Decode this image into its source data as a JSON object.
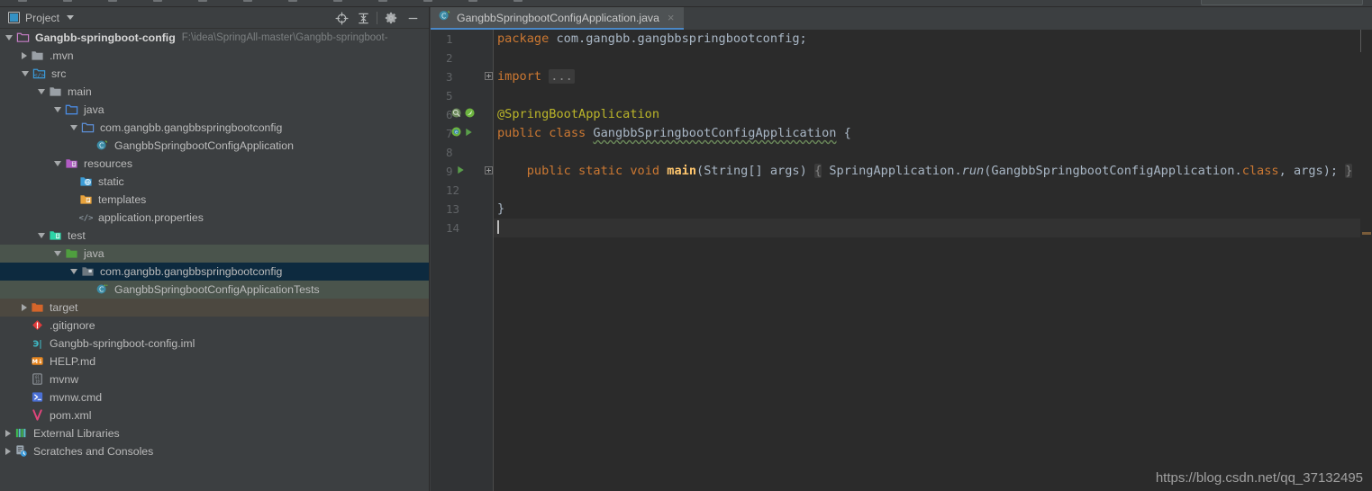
{
  "panel": {
    "title": "Project",
    "buttons": [
      {
        "name": "locate-icon",
        "label": "Select Opened File"
      },
      {
        "name": "collapse-all-icon",
        "label": "Collapse All"
      },
      {
        "name": "gear-icon",
        "label": "Settings"
      },
      {
        "name": "minimize-icon",
        "label": "Hide"
      }
    ]
  },
  "tree": [
    {
      "label": "Gangbb-springboot-config",
      "path": "F:\\idea\\SpringAll-master\\Gangbb-springboot-",
      "indent": 0,
      "arrow": "open",
      "icon": "module-folder-icon",
      "bold": true,
      "highlight": "none"
    },
    {
      "label": ".mvn",
      "indent": 1,
      "arrow": "closed",
      "icon": "folder-icon",
      "bold": false,
      "highlight": "none"
    },
    {
      "label": "src",
      "indent": 1,
      "arrow": "open",
      "icon": "source-root-icon",
      "bold": false,
      "highlight": "none"
    },
    {
      "label": "main",
      "indent": 2,
      "arrow": "open",
      "icon": "folder-icon",
      "bold": false,
      "highlight": "none"
    },
    {
      "label": "java",
      "indent": 3,
      "arrow": "open",
      "icon": "java-source-folder-icon",
      "bold": false,
      "highlight": "none"
    },
    {
      "label": "com.gangbb.gangbbspringbootconfig",
      "indent": 4,
      "arrow": "open",
      "icon": "package-icon",
      "bold": false,
      "highlight": "none"
    },
    {
      "label": "GangbbSpringbootConfigApplication",
      "indent": 5,
      "arrow": "none",
      "icon": "spring-class-icon",
      "bold": false,
      "highlight": "none"
    },
    {
      "label": "resources",
      "indent": 3,
      "arrow": "open",
      "icon": "resources-root-icon",
      "bold": false,
      "highlight": "none"
    },
    {
      "label": "static",
      "indent": 4,
      "arrow": "none",
      "icon": "static-folder-icon",
      "bold": false,
      "highlight": "none"
    },
    {
      "label": "templates",
      "indent": 4,
      "arrow": "none",
      "icon": "templates-folder-icon",
      "bold": false,
      "highlight": "none"
    },
    {
      "label": "application.properties",
      "indent": 4,
      "arrow": "none",
      "icon": "properties-file-icon",
      "bold": false,
      "highlight": "none"
    },
    {
      "label": "test",
      "indent": 2,
      "arrow": "open",
      "icon": "test-root-icon",
      "bold": false,
      "highlight": "none"
    },
    {
      "label": "java",
      "indent": 3,
      "arrow": "open",
      "icon": "test-source-folder-icon",
      "bold": false,
      "highlight": "green"
    },
    {
      "label": "com.gangbb.gangbbspringbootconfig",
      "indent": 4,
      "arrow": "open",
      "icon": "test-package-icon",
      "bold": false,
      "highlight": "blue"
    },
    {
      "label": "GangbbSpringbootConfigApplicationTests",
      "indent": 5,
      "arrow": "none",
      "icon": "test-class-icon",
      "bold": false,
      "highlight": "green"
    },
    {
      "label": "target",
      "indent": 1,
      "arrow": "closed",
      "icon": "excluded-folder-icon",
      "bold": false,
      "highlight": "brown"
    },
    {
      "label": ".gitignore",
      "indent": 1,
      "arrow": "none",
      "icon": "gitignore-icon",
      "bold": false,
      "highlight": "none"
    },
    {
      "label": "Gangbb-springboot-config.iml",
      "indent": 1,
      "arrow": "none",
      "icon": "iml-file-icon",
      "bold": false,
      "highlight": "none"
    },
    {
      "label": "HELP.md",
      "indent": 1,
      "arrow": "none",
      "icon": "markdown-file-icon",
      "bold": false,
      "highlight": "none"
    },
    {
      "label": "mvnw",
      "indent": 1,
      "arrow": "none",
      "icon": "binary-file-icon",
      "bold": false,
      "highlight": "none"
    },
    {
      "label": "mvnw.cmd",
      "indent": 1,
      "arrow": "none",
      "icon": "cmd-file-icon",
      "bold": false,
      "highlight": "none"
    },
    {
      "label": "pom.xml",
      "indent": 1,
      "arrow": "none",
      "icon": "maven-pom-icon",
      "bold": false,
      "highlight": "none"
    },
    {
      "label": "External Libraries",
      "indent": 0,
      "arrow": "closed",
      "icon": "libraries-icon",
      "bold": false,
      "highlight": "none"
    },
    {
      "label": "Scratches and Consoles",
      "indent": 0,
      "arrow": "closed",
      "icon": "scratches-icon",
      "bold": false,
      "highlight": "none"
    }
  ],
  "editor": {
    "tab": {
      "label": "GangbbSpringbootConfigApplication.java",
      "icon": "spring-class-icon",
      "close": "×"
    },
    "line_numbers": [
      "1",
      "2",
      "3",
      "5",
      "6",
      "7",
      "8",
      "9",
      "12",
      "13",
      "14"
    ],
    "lines": [
      {
        "num": "1",
        "text": "package com.gangbb.gangbbspringbootconfig;"
      },
      {
        "num": "2",
        "text": ""
      },
      {
        "num": "3",
        "text": "import ..."
      },
      {
        "num": "5",
        "text": ""
      },
      {
        "num": "6",
        "text": "@SpringBootApplication"
      },
      {
        "num": "7",
        "text": "public class GangbbSpringbootConfigApplication {"
      },
      {
        "num": "8",
        "text": ""
      },
      {
        "num": "9",
        "text": "    public static void main(String[] args) { SpringApplication.run(GangbbSpringbootConfigApplication.class, args); }"
      },
      {
        "num": "12",
        "text": ""
      },
      {
        "num": "13",
        "text": "}"
      },
      {
        "num": "14",
        "text": ""
      }
    ],
    "tokens": {
      "kw_package": "package",
      "pkg_name": " com.gangbb.gangbbspringbootconfig;",
      "kw_import": "import",
      "import_fold": "...",
      "annotation": "@SpringBootApplication",
      "kw_public": "public",
      "kw_class": "class",
      "class_name": "GangbbSpringbootConfigApplication",
      "brace_open": "{",
      "kw_static": "static",
      "kw_void": "void",
      "method_name": "main",
      "method_params": "(String[] args)",
      "body_open": "{",
      "spring_app": " SpringApplication.",
      "run_method": "run",
      "run_args_a": "(GangbbSpringbootConfigApplication.",
      "kw_class2": "class",
      "run_args_b": ", args);",
      "body_close": "}",
      "brace_close": "}"
    },
    "gutter_icons": {
      "line6": [
        "spring-bean-icon",
        "spring-leaf-icon"
      ],
      "line7": [
        "spring-boot-icon",
        "run-arrow-icon"
      ],
      "line9": [
        "run-arrow-icon"
      ]
    }
  },
  "watermark": "https://blog.csdn.net/qq_37132495"
}
